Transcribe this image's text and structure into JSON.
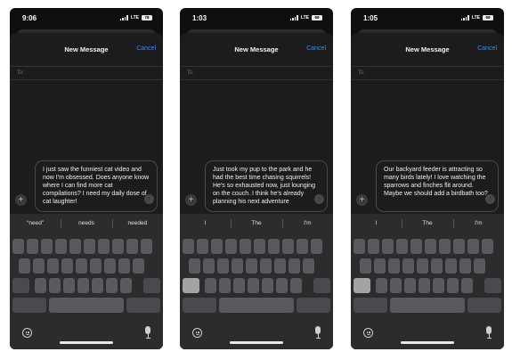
{
  "screens": [
    {
      "time": "9:06",
      "network": "LTE",
      "battery": "78",
      "nav_title": "New Message",
      "cancel_label": "Cancel",
      "to_label": "To:",
      "message": "I just saw the funniest cat video and now I'm obsessed. Does anyone know where I can find more cat compilations? I need my daily dose of cat laughter!",
      "predictions": [
        "“need”",
        "needs",
        "needed"
      ],
      "pressed_key": "none"
    },
    {
      "time": "1:03",
      "network": "LTE",
      "battery": "69",
      "nav_title": "New Message",
      "cancel_label": "Cancel",
      "to_label": "To:",
      "message": "Just took my pup to the park and he had the best time chasing squirrels! He's so exhausted now, just lounging on the couch. I think he's already planning his next adventure",
      "predictions": [
        "I",
        "The",
        "I'm"
      ],
      "pressed_key": "shift"
    },
    {
      "time": "1:05",
      "network": "LTE",
      "battery": "69",
      "nav_title": "New Message",
      "cancel_label": "Cancel",
      "to_label": "To:",
      "message": "Our backyard feeder is attracting so many birds lately! I love watching the sparrows and finches flit around. Maybe we should add a birdbath too?",
      "predictions": [
        "I",
        "The",
        "I'm"
      ],
      "pressed_key": "shift"
    }
  ],
  "icons": {
    "add": "plus-icon",
    "send": "arrow-up-icon",
    "emoji": "emoji-icon",
    "dictation": "microphone-icon"
  },
  "colors": {
    "accent": "#3d8bf0",
    "sheet": "#1c1c1e",
    "keyboard": "#2c2c2e",
    "key": "#59595e"
  }
}
